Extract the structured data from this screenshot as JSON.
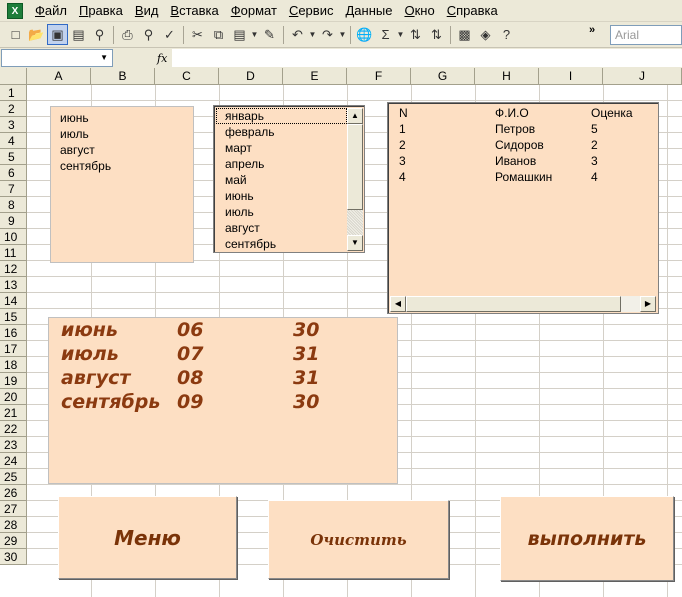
{
  "menu": [
    "Файл",
    "Правка",
    "Вид",
    "Вставка",
    "Формат",
    "Сервис",
    "Данные",
    "Окно",
    "Справка"
  ],
  "app_icon": "excel-icon",
  "toolbar": {
    "font_name": "Arial",
    "more": "»",
    "icons": [
      "new-icon",
      "open-icon",
      "save-icon",
      "permission-icon",
      "search-icon",
      "print-icon",
      "print-preview-icon",
      "spelling-icon",
      "cut-icon",
      "copy-icon",
      "paste-icon",
      "format-painter-icon",
      "undo-icon",
      "redo-icon",
      "hyperlink-icon",
      "autosum-icon",
      "sort-asc-icon",
      "sort-desc-icon",
      "chart-icon",
      "drawing-icon",
      "help-icon"
    ]
  },
  "formula_bar": {
    "fx": "fx",
    "name_box": "",
    "value": ""
  },
  "columns": [
    "A",
    "B",
    "C",
    "D",
    "E",
    "F",
    "G",
    "H",
    "I",
    "J"
  ],
  "rows": [
    "1",
    "2",
    "3",
    "4",
    "5",
    "6",
    "7",
    "8",
    "9",
    "10",
    "11",
    "12",
    "13",
    "14",
    "15",
    "16",
    "17",
    "18",
    "19",
    "20",
    "21",
    "22",
    "23",
    "24",
    "25",
    "26",
    "27",
    "28",
    "29",
    "30"
  ],
  "listbox_selected": [
    "июнь",
    "июль",
    "август",
    "сентябрь"
  ],
  "listbox_months": [
    "январь",
    "февраль",
    "март",
    "апрель",
    "май",
    "июнь",
    "июль",
    "август",
    "сентябрь"
  ],
  "table": {
    "headers": [
      "N",
      "Ф.И.О",
      "Оценка"
    ],
    "rows": [
      [
        "1",
        "Петров",
        "5"
      ],
      [
        "2",
        "Сидоров",
        "2"
      ],
      [
        "3",
        "Иванов",
        "3"
      ],
      [
        "4",
        "Ромашкин",
        "4"
      ]
    ]
  },
  "result": [
    [
      "июнь",
      "06",
      "30"
    ],
    [
      "июль",
      "07",
      "31"
    ],
    [
      "август",
      "08",
      "31"
    ],
    [
      "сентябрь",
      "09",
      "30"
    ]
  ],
  "buttons": {
    "menu": "Меню",
    "clear": "Очистить",
    "run": "выполнить"
  },
  "colors": {
    "panel": "#fddfc3",
    "accent_text": "#8b3a10",
    "chrome": "#ece9d8"
  }
}
